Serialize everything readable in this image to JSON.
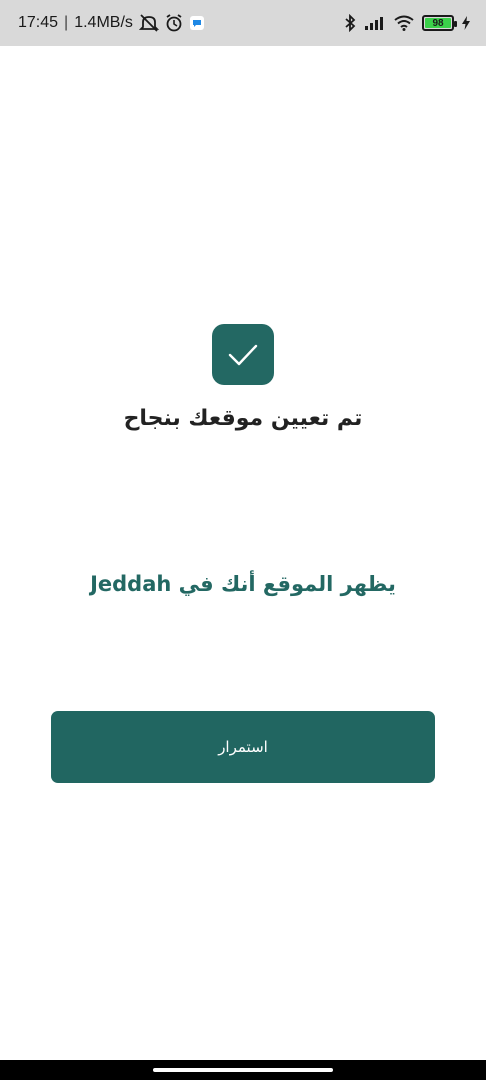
{
  "status_bar": {
    "time": "17:45",
    "separator": "|",
    "network_speed": "1.4MB/s",
    "icons": [
      "mute-icon",
      "alarm-icon",
      "notification-icon",
      "bluetooth-icon",
      "signal-icon",
      "wifi-icon",
      "battery-icon",
      "charging-icon"
    ],
    "battery_level": "98",
    "battery_color": "#3bd14a"
  },
  "success": {
    "icon": "checkmark-icon",
    "title": "تم تعيين موقعك بنجاح"
  },
  "location": {
    "message": "يظهر الموقع أنك في Jeddah"
  },
  "actions": {
    "continue_label": "استمرار"
  },
  "colors": {
    "brand": "#236863",
    "button": "#216661",
    "status_bar_bg": "#d9d9d9"
  }
}
